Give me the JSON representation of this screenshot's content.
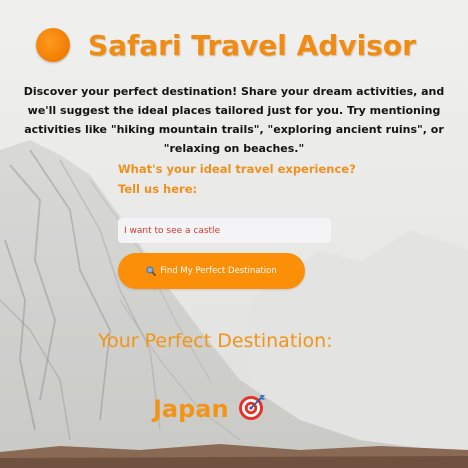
{
  "app": {
    "title": "Safari Travel Advisor",
    "intro": "Discover your perfect destination! Share your dream activities, and we'll suggest the ideal places tailored just for you. Try mentioning activities like \"hiking mountain trails\", \"exploring ancient ruins\", or \"relaxing on beaches.\"",
    "accent_color": "#f08c14"
  },
  "form": {
    "prompt_line1": "What's your ideal travel experience?",
    "prompt_line2": "Tell us here:",
    "input_value": "I want to see a castle",
    "button_icon": "magnifier-icon",
    "button_label": "Find My Perfect Destination"
  },
  "result": {
    "heading": "Your Perfect Destination:",
    "destination": "Japan",
    "destination_icon": "target-dart-icon"
  }
}
